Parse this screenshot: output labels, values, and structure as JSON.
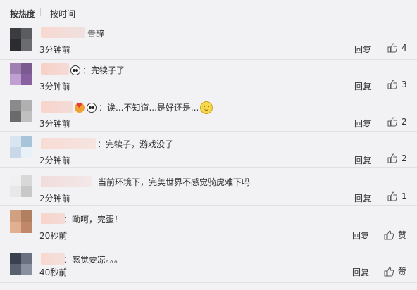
{
  "sort": {
    "hot": "按热度",
    "time": "按时间"
  },
  "comments": [
    {
      "text": "告辞",
      "time": "3分钟前",
      "reply": "回复",
      "likes": "4",
      "avatar": [
        "#3a3c40",
        "#5a5c60",
        "#2a2c30",
        "#6a6c70"
      ],
      "name_width": 66
    },
    {
      "text": "：完犊子了",
      "time": "3分钟前",
      "reply": "回复",
      "likes": "3",
      "avatar": [
        "#a080b0",
        "#7a5a90",
        "#c0a0d0",
        "#8860a0"
      ],
      "name_width": 40
    },
    {
      "text": "：诶...不知道...是好还是...",
      "time": "3分钟前",
      "reply": "回复",
      "likes": "2",
      "avatar": [
        "#8a8a8a",
        "#b0b0b0",
        "#6a6a6a",
        "#c0c0c0"
      ],
      "name_width": 44
    },
    {
      "text": "：完犊子，游戏没了",
      "time": "2分钟前",
      "reply": "回复",
      "likes": "2",
      "avatar": [
        "#d8e4f0",
        "#a8c4d8",
        "#c8d8e8",
        "#e8f0f8"
      ],
      "name_width": 78
    },
    {
      "text": "当前环境下，完美世界不感觉骑虎难下吗",
      "time": "2分钟前",
      "reply": "回复",
      "likes": "1",
      "avatar": [
        "#f0f0f0",
        "#d8d8d8",
        "#e8e8e8",
        "#c8c8c8"
      ],
      "name_width": 72
    },
    {
      "text": "：呦呵，完蛋！",
      "time": "20秒前",
      "reply": "回复",
      "likes": "赞",
      "avatar": [
        "#d0a080",
        "#b08060",
        "#e0b090",
        "#c08868"
      ],
      "name_width": 34
    },
    {
      "text": "：感觉要凉。。。",
      "time": "40秒前",
      "reply": "回复",
      "likes": "赞",
      "avatar": [
        "#3a4050",
        "#6a7080",
        "#5a6070",
        "#8a90a0"
      ],
      "name_width": 34
    }
  ]
}
